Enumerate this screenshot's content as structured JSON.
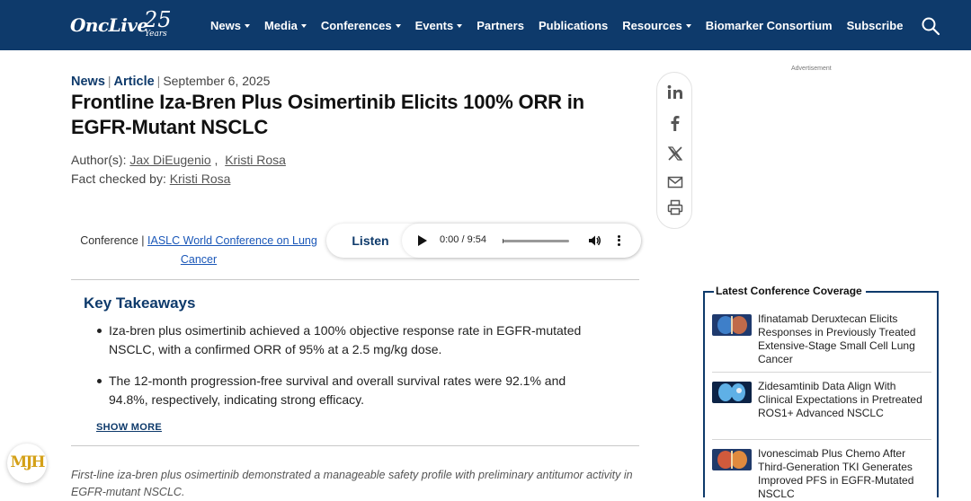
{
  "header": {
    "logo": {
      "word": "OncLive",
      "number": "25",
      "years": "Years"
    },
    "nav": [
      {
        "label": "News",
        "dropdown": true
      },
      {
        "label": "Media",
        "dropdown": true
      },
      {
        "label": "Conferences",
        "dropdown": true
      },
      {
        "label": "Events",
        "dropdown": true
      },
      {
        "label": "Partners",
        "dropdown": false
      },
      {
        "label": "Publications",
        "dropdown": false
      },
      {
        "label": "Resources",
        "dropdown": true
      },
      {
        "label": "Biomarker Consortium",
        "dropdown": false
      },
      {
        "label": "Subscribe",
        "dropdown": false
      }
    ],
    "search_icon": "search-icon"
  },
  "article": {
    "category": "News",
    "type": "Article",
    "date": "September 6, 2025",
    "title": "Frontline Iza-Bren Plus Osimertinib Elicits 100% ORR in EGFR-Mutant NSCLC",
    "authors_label": "Author(s):",
    "authors": [
      "Jax DiEugenio",
      "Kristi Rosa"
    ],
    "fact_label": "Fact checked by:",
    "fact_checker": "Kristi Rosa",
    "conference_label": "Conference |",
    "conference_name": "IASLC World Conference on Lung Cancer"
  },
  "audio": {
    "listen_label": "Listen",
    "time": "0:00 / 9:54",
    "progress": 0.02
  },
  "takeaways": {
    "title": "Key Takeaways",
    "items": [
      "Iza-bren plus osimertinib achieved a 100% objective response rate in EGFR-mutated NSCLC, with a confirmed ORR of 95% at a 2.5 mg/kg dose.",
      "The 12-month progression-free survival and overall survival rates were 92.1% and 94.8%, respectively, indicating strong efficacy."
    ],
    "show_more": "SHOW MORE"
  },
  "summary": "First-line iza-bren plus osimertinib demonstrated a manageable safety profile with preliminary antitumor activity in EGFR-mutant NSCLC.",
  "share": [
    "linkedin-icon",
    "facebook-icon",
    "x-icon",
    "mail-icon",
    "print-icon"
  ],
  "sidebar": {
    "ad_label": "Advertisement",
    "latest_title": "Latest Conference Coverage",
    "items": [
      {
        "title": "Ifinatamab Deruxtecan Elicits Responses in Previously Treated Extensive-Stage Small Cell Lung Cancer"
      },
      {
        "title": "Zidesamtinib Data Align With Clinical Expectations in Pretreated ROS1+ Advanced NSCLC"
      },
      {
        "title": "Ivonescimab Plus Chemo After Third-Generation TKI Generates Improved PFS in EGFR-Mutated NSCLC"
      }
    ]
  },
  "badge": {
    "text": "MJH"
  },
  "colors": {
    "brand": "#0e3a6b",
    "link": "#1a57b8",
    "badge_gold": "#d4a017"
  }
}
